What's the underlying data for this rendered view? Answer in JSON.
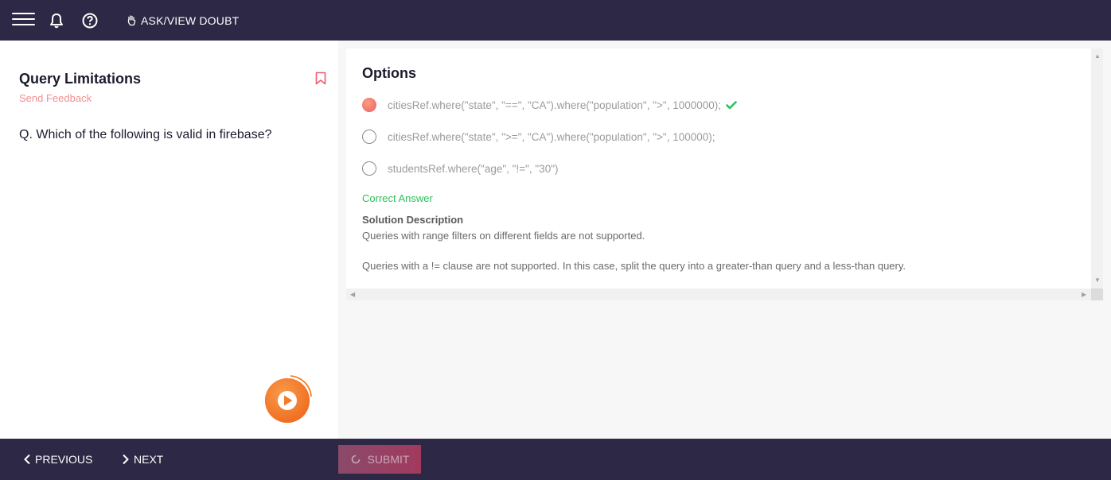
{
  "topbar": {
    "ask_label": "ASK/VIEW DOUBT",
    "icons": [
      "menu-icon",
      "bell-icon",
      "help-icon",
      "hand-icon"
    ]
  },
  "question": {
    "title": "Query Limitations",
    "feedback_label": "Send Feedback",
    "text": "Q. Which of the following is valid in firebase?"
  },
  "options": {
    "heading": "Options",
    "items": [
      {
        "text": "citiesRef.where(\"state\", \"==\", \"CA\").where(\"population\", \">\", 1000000);",
        "selected": true,
        "correct": true
      },
      {
        "text": "citiesRef.where(\"state\", \">=\", \"CA\").where(\"population\", \">\", 100000);",
        "selected": false,
        "correct": false
      },
      {
        "text": "studentsRef.where(\"age\", \"!=\", \"30\")",
        "selected": false,
        "correct": false
      }
    ],
    "correct_label": "Correct Answer",
    "solution_label": "Solution Description",
    "solution_lines": [
      "Queries with range filters on different fields are not supported.",
      "Queries with a != clause are not supported. In this case, split the query into a greater-than query and a less-than query."
    ]
  },
  "bottombar": {
    "previous_label": "PREVIOUS",
    "next_label": "NEXT",
    "submit_label": "SUBMIT"
  },
  "colors": {
    "nav_bg": "#2c2845",
    "accent": "#f28f8f",
    "correct": "#2ec05a",
    "play": "#f47d2b"
  }
}
